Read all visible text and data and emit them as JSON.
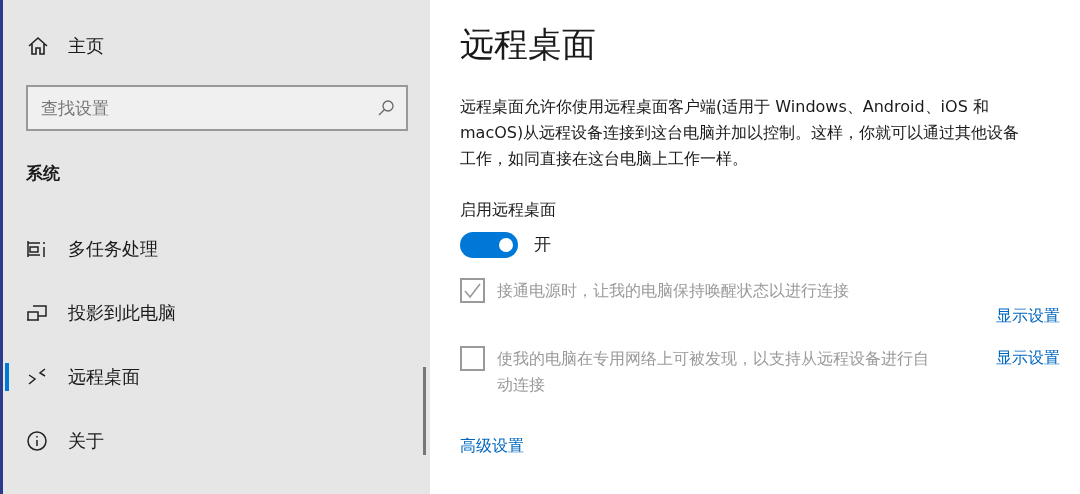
{
  "sidebar": {
    "home": {
      "label": "主页"
    },
    "search": {
      "placeholder": "查找设置"
    },
    "section": "系统",
    "items": [
      {
        "label": "多任务处理",
        "kind": "multitask",
        "selected": false
      },
      {
        "label": "投影到此电脑",
        "kind": "project",
        "selected": false
      },
      {
        "label": "远程桌面",
        "kind": "remote",
        "selected": true
      },
      {
        "label": "关于",
        "kind": "info",
        "selected": false
      }
    ]
  },
  "page": {
    "title": "远程桌面",
    "description": "远程桌面允许你使用远程桌面客户端(适用于 Windows、Android、iOS 和 macOS)从远程设备连接到这台电脑并加以控制。这样，你就可以通过其他设备工作，如同直接在这台电脑上工作一样。",
    "toggle": {
      "label": "启用远程桌面",
      "on": true,
      "state_text": "开"
    },
    "options": [
      {
        "label": "接通电源时，让我的电脑保持唤醒状态以进行连接",
        "checked": true,
        "disabled": true,
        "link": "显示设置",
        "link_below": true
      },
      {
        "label": "使我的电脑在专用网络上可被发现，以支持从远程设备进行自动连接",
        "checked": false,
        "disabled": true,
        "link": "显示设置",
        "link_below": false
      }
    ],
    "advanced_link": "高级设置"
  }
}
